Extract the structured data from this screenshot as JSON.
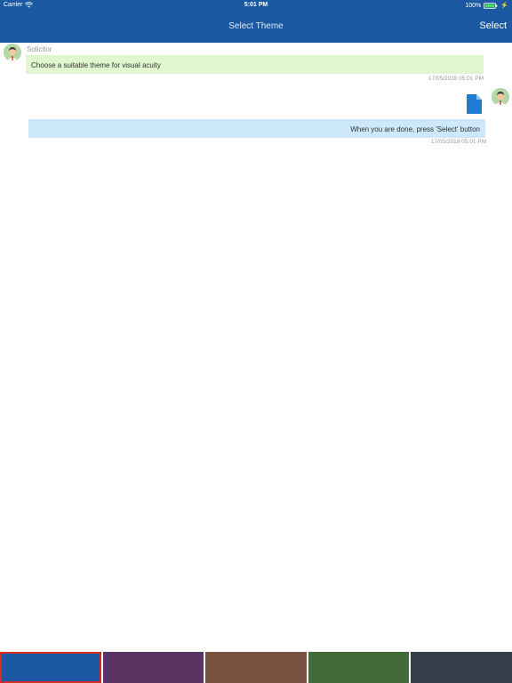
{
  "status_bar": {
    "carrier": "Carrier",
    "time": "5:01 PM",
    "battery_percent": "100%"
  },
  "navigation": {
    "title": "Select Theme",
    "select_label": "Select"
  },
  "messages": [
    {
      "sender": "Solicitor",
      "text": "Choose a suitable theme for visual acuity",
      "timestamp": "17/05/2018 05:01 PM",
      "color": "#dff6cf"
    },
    {
      "attachment_icon": "document-icon",
      "text": "When you are done, press 'Select' button",
      "timestamp": "17/05/2018 05:01 PM",
      "color": "#cde8fa"
    }
  ],
  "themes": {
    "selected_index": 0,
    "selected_border_color": "#d62b2b",
    "swatches": [
      {
        "color": "#1b5aa3"
      },
      {
        "color": "#5a3563"
      },
      {
        "color": "#7a5141"
      },
      {
        "color": "#416b36"
      },
      {
        "color": "#343e4a"
      }
    ]
  }
}
